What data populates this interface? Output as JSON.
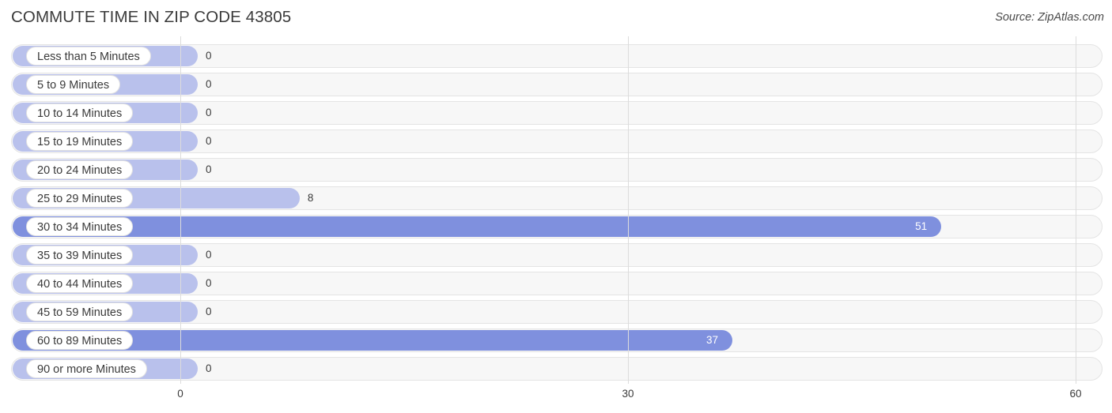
{
  "header": {
    "title": "COMMUTE TIME IN ZIP CODE 43805",
    "source": "Source: ZipAtlas.com"
  },
  "colors": {
    "bar_light": "#b9c1ec",
    "bar_strong": "#7f90de",
    "track_bg": "#f7f7f7",
    "track_border": "#e4e4e4",
    "gridline": "#dcdcdc",
    "text": "#3a3a3a",
    "value_inside": "#ffffff"
  },
  "chart_data": {
    "type": "bar",
    "orientation": "horizontal",
    "title": "COMMUTE TIME IN ZIP CODE 43805",
    "xlabel": "",
    "ylabel": "",
    "xlim": [
      0,
      60
    ],
    "ticks": [
      "0",
      "30",
      "60"
    ],
    "tick_values": [
      0,
      30,
      60
    ],
    "grid": true,
    "legend": null,
    "categories": [
      "Less than 5 Minutes",
      "5 to 9 Minutes",
      "10 to 14 Minutes",
      "15 to 19 Minutes",
      "20 to 24 Minutes",
      "25 to 29 Minutes",
      "30 to 34 Minutes",
      "35 to 39 Minutes",
      "40 to 44 Minutes",
      "45 to 59 Minutes",
      "60 to 89 Minutes",
      "90 or more Minutes"
    ],
    "values": [
      0,
      0,
      0,
      0,
      0,
      8,
      51,
      0,
      0,
      0,
      37,
      0
    ],
    "value_labels": [
      "0",
      "0",
      "0",
      "0",
      "0",
      "8",
      "51",
      "0",
      "0",
      "0",
      "37",
      "0"
    ]
  },
  "rows": [
    {
      "label": "Less than 5 Minutes",
      "value": 0,
      "value_label": "0",
      "color": "#b9c1ec",
      "label_inside": false
    },
    {
      "label": "5 to 9 Minutes",
      "value": 0,
      "value_label": "0",
      "color": "#b9c1ec",
      "label_inside": false
    },
    {
      "label": "10 to 14 Minutes",
      "value": 0,
      "value_label": "0",
      "color": "#b9c1ec",
      "label_inside": false
    },
    {
      "label": "15 to 19 Minutes",
      "value": 0,
      "value_label": "0",
      "color": "#b9c1ec",
      "label_inside": false
    },
    {
      "label": "20 to 24 Minutes",
      "value": 0,
      "value_label": "0",
      "color": "#b9c1ec",
      "label_inside": false
    },
    {
      "label": "25 to 29 Minutes",
      "value": 8,
      "value_label": "8",
      "color": "#b9c1ec",
      "label_inside": false
    },
    {
      "label": "30 to 34 Minutes",
      "value": 51,
      "value_label": "51",
      "color": "#7f90de",
      "label_inside": true
    },
    {
      "label": "35 to 39 Minutes",
      "value": 0,
      "value_label": "0",
      "color": "#b9c1ec",
      "label_inside": false
    },
    {
      "label": "40 to 44 Minutes",
      "value": 0,
      "value_label": "0",
      "color": "#b9c1ec",
      "label_inside": false
    },
    {
      "label": "45 to 59 Minutes",
      "value": 0,
      "value_label": "0",
      "color": "#b9c1ec",
      "label_inside": false
    },
    {
      "label": "60 to 89 Minutes",
      "value": 37,
      "value_label": "37",
      "color": "#7f90de",
      "label_inside": true
    },
    {
      "label": "90 or more Minutes",
      "value": 0,
      "value_label": "0",
      "color": "#b9c1ec",
      "label_inside": false
    }
  ]
}
